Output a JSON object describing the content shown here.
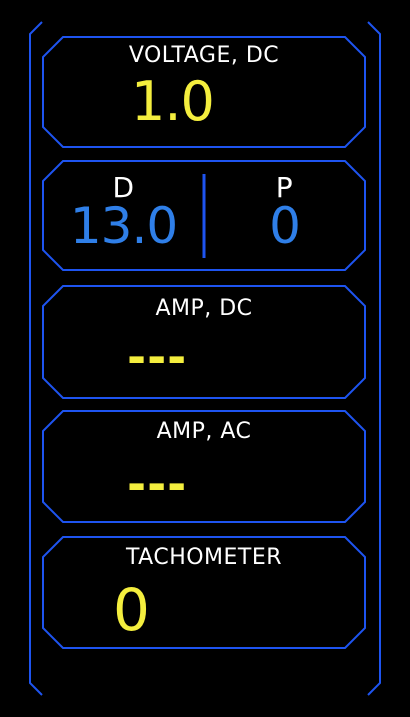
{
  "colors": {
    "frame": "#1e54f0",
    "value_yellow": "#f4ee3e",
    "value_blue": "#2f7fe8",
    "label": "#ffffff",
    "background": "#000000"
  },
  "voltage_dc": {
    "label": "VOLTAGE, DC",
    "value": "1.0"
  },
  "dp": {
    "d": {
      "label": "D",
      "value": "13.0"
    },
    "p": {
      "label": "P",
      "value": "0"
    }
  },
  "amp_dc": {
    "label": "AMP, DC",
    "value": "---"
  },
  "amp_ac": {
    "label": "AMP, AC",
    "value": "---"
  },
  "tachometer": {
    "label": "TACHOMETER",
    "value": "0"
  }
}
